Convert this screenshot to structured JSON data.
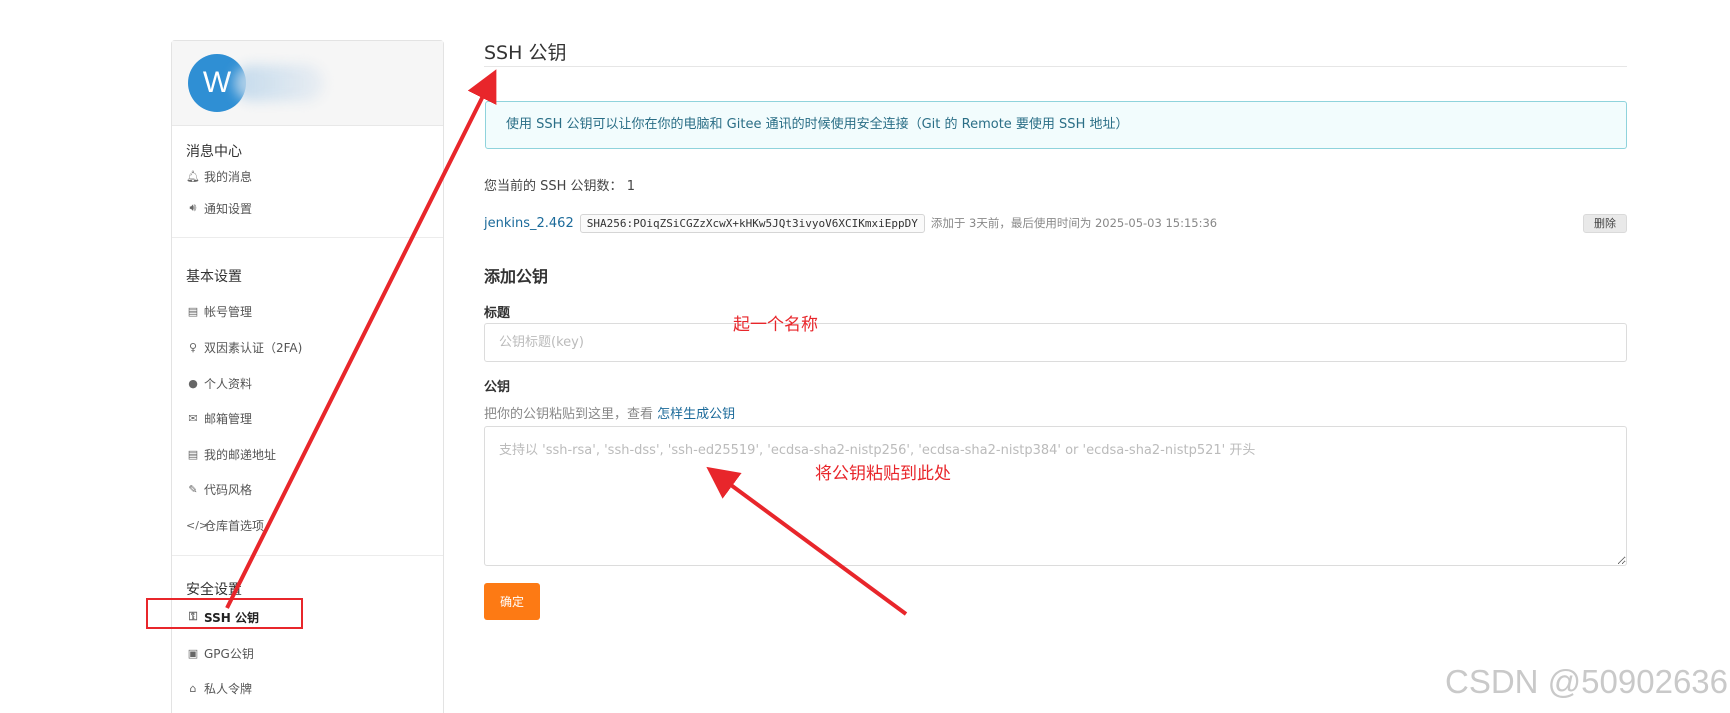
{
  "sidebar": {
    "avatar_letter": "W",
    "groups": [
      {
        "title": "消息中心",
        "items": [
          {
            "icon": "bell-icon",
            "label": "我的消息"
          },
          {
            "icon": "speaker-icon",
            "label": "通知设置"
          }
        ]
      },
      {
        "title": "基本设置",
        "items": [
          {
            "icon": "id-card-icon",
            "label": "帐号管理"
          },
          {
            "icon": "user-key-icon",
            "label": "双因素认证（2FA)"
          },
          {
            "icon": "user-icon",
            "label": "个人资料"
          },
          {
            "icon": "mail-icon",
            "label": "邮箱管理"
          },
          {
            "icon": "address-card-icon",
            "label": "我的邮递地址"
          },
          {
            "icon": "brush-icon",
            "label": "代码风格"
          },
          {
            "icon": "code-icon",
            "label": "仓库首选项"
          }
        ]
      },
      {
        "title": "安全设置",
        "items": [
          {
            "icon": "key-icon",
            "label": "SSH 公钥",
            "active": true
          },
          {
            "icon": "lock-icon",
            "label": "GPG公钥"
          },
          {
            "icon": "token-icon",
            "label": "私人令牌"
          }
        ]
      }
    ]
  },
  "main": {
    "title": "SSH 公钥",
    "info": "使用 SSH 公钥可以让你在你的电脑和 Gitee 通讯的时候使用安全连接（Git 的 Remote 要使用 SSH 地址）",
    "count_label": "您当前的 SSH 公钥数：",
    "count_value": "1",
    "key": {
      "name": "jenkins_2.462",
      "fingerprint": "SHA256:POiqZSiCGZzXcwX+kHKw5JQt3ivyoV6XCIKmxiEppDY",
      "meta": "添加于 3天前，最后使用时间为 2025-05-03 15:15:36",
      "delete_label": "删除"
    },
    "add_section_title": "添加公钥",
    "title_field": {
      "label": "标题",
      "placeholder": "公钥标题(key)"
    },
    "key_field": {
      "label": "公钥",
      "hint": "把你的公钥粘贴到这里，查看",
      "hint_link": "怎样生成公钥",
      "placeholder": "支持以 'ssh-rsa', 'ssh-dss', 'ssh-ed25519', 'ecdsa-sha2-nistp256', 'ecdsa-sha2-nistp384' or 'ecdsa-sha2-nistp521' 开头"
    },
    "submit_label": "确定"
  },
  "annotations": {
    "name_note": "起一个名称",
    "paste_note": "将公钥粘贴到此处"
  },
  "watermark": "CSDN @50902636",
  "colors": {
    "accent_orange": "#fd7a14",
    "link_blue": "#1b6a9a",
    "annotation_red": "#e8262b",
    "info_border": "#8fd3dc"
  }
}
